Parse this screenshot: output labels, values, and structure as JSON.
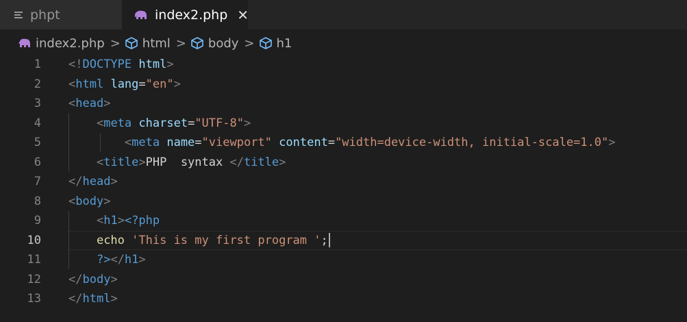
{
  "tabs": [
    {
      "label": "phpt",
      "icon": "file-lines-icon",
      "active": false
    },
    {
      "label": "index2.php",
      "icon": "php-elephant-icon",
      "active": true,
      "close": "✕"
    }
  ],
  "breadcrumb": {
    "file": "index2.php",
    "items": [
      "html",
      "body",
      "h1"
    ],
    "separator": ">"
  },
  "editor": {
    "current_line": 10,
    "lines": [
      {
        "n": "1",
        "tokens": [
          [
            "t-tag",
            "<!"
          ],
          [
            "t-name",
            "DOCTYPE"
          ],
          [
            "t-txt",
            " "
          ],
          [
            "t-attr",
            "html"
          ],
          [
            "t-tag",
            ">"
          ]
        ]
      },
      {
        "n": "2",
        "tokens": [
          [
            "t-tag",
            "<"
          ],
          [
            "t-name",
            "html"
          ],
          [
            "t-txt",
            " "
          ],
          [
            "t-attr",
            "lang"
          ],
          [
            "t-txt",
            "="
          ],
          [
            "t-str",
            "\"en\""
          ],
          [
            "t-tag",
            ">"
          ]
        ]
      },
      {
        "n": "3",
        "tokens": [
          [
            "t-tag",
            "<"
          ],
          [
            "t-name",
            "head"
          ],
          [
            "t-tag",
            ">"
          ]
        ]
      },
      {
        "n": "4",
        "tokens": [
          [
            "t-txt",
            "    "
          ],
          [
            "t-tag",
            "<"
          ],
          [
            "t-name",
            "meta"
          ],
          [
            "t-txt",
            " "
          ],
          [
            "t-attr",
            "charset"
          ],
          [
            "t-txt",
            "="
          ],
          [
            "t-str",
            "\"UTF-8\""
          ],
          [
            "t-tag",
            ">"
          ]
        ]
      },
      {
        "n": "5",
        "tokens": [
          [
            "t-txt",
            "        "
          ],
          [
            "t-tag",
            "<"
          ],
          [
            "t-name",
            "meta"
          ],
          [
            "t-txt",
            " "
          ],
          [
            "t-attr",
            "name"
          ],
          [
            "t-txt",
            "="
          ],
          [
            "t-str",
            "\"viewport\""
          ],
          [
            "t-txt",
            " "
          ],
          [
            "t-attr",
            "content"
          ],
          [
            "t-txt",
            "="
          ],
          [
            "t-str",
            "\"width=device-width, initial-scale=1.0\""
          ],
          [
            "t-tag",
            ">"
          ]
        ]
      },
      {
        "n": "6",
        "tokens": [
          [
            "t-txt",
            "    "
          ],
          [
            "t-tag",
            "<"
          ],
          [
            "t-name",
            "title"
          ],
          [
            "t-tag",
            ">"
          ],
          [
            "t-txt",
            "PHP  syntax "
          ],
          [
            "t-tag",
            "</"
          ],
          [
            "t-name",
            "title"
          ],
          [
            "t-tag",
            ">"
          ]
        ]
      },
      {
        "n": "7",
        "tokens": [
          [
            "t-tag",
            "</"
          ],
          [
            "t-name",
            "head"
          ],
          [
            "t-tag",
            ">"
          ]
        ]
      },
      {
        "n": "8",
        "tokens": [
          [
            "t-tag",
            "<"
          ],
          [
            "t-name",
            "body"
          ],
          [
            "t-tag",
            ">"
          ]
        ]
      },
      {
        "n": "9",
        "tokens": [
          [
            "t-txt",
            "    "
          ],
          [
            "t-tag",
            "<"
          ],
          [
            "t-name",
            "h1"
          ],
          [
            "t-tag",
            ">"
          ],
          [
            "t-name",
            "<?php"
          ]
        ]
      },
      {
        "n": "10",
        "tokens": [
          [
            "t-txt",
            "    "
          ],
          [
            "t-fn",
            "echo"
          ],
          [
            "t-txt",
            " "
          ],
          [
            "t-str",
            "'This is my first program '"
          ],
          [
            "t-txt",
            ";"
          ]
        ],
        "cursor": true
      },
      {
        "n": "11",
        "tokens": [
          [
            "t-txt",
            "    "
          ],
          [
            "t-name",
            "?>"
          ],
          [
            "t-tag",
            "</"
          ],
          [
            "t-name",
            "h1"
          ],
          [
            "t-tag",
            ">"
          ]
        ]
      },
      {
        "n": "12",
        "tokens": [
          [
            "t-tag",
            "</"
          ],
          [
            "t-name",
            "body"
          ],
          [
            "t-tag",
            ">"
          ]
        ]
      },
      {
        "n": "13",
        "tokens": [
          [
            "t-tag",
            "</"
          ],
          [
            "t-name",
            "html"
          ],
          [
            "t-tag",
            ">"
          ]
        ]
      }
    ]
  },
  "colors": {
    "background": "#1e1e1e",
    "tag_bracket": "#808080",
    "tag_name": "#569cd6",
    "attribute": "#9cdcfe",
    "string": "#ce9178",
    "function": "#dcdcaa",
    "php_icon": "#b180d7"
  }
}
